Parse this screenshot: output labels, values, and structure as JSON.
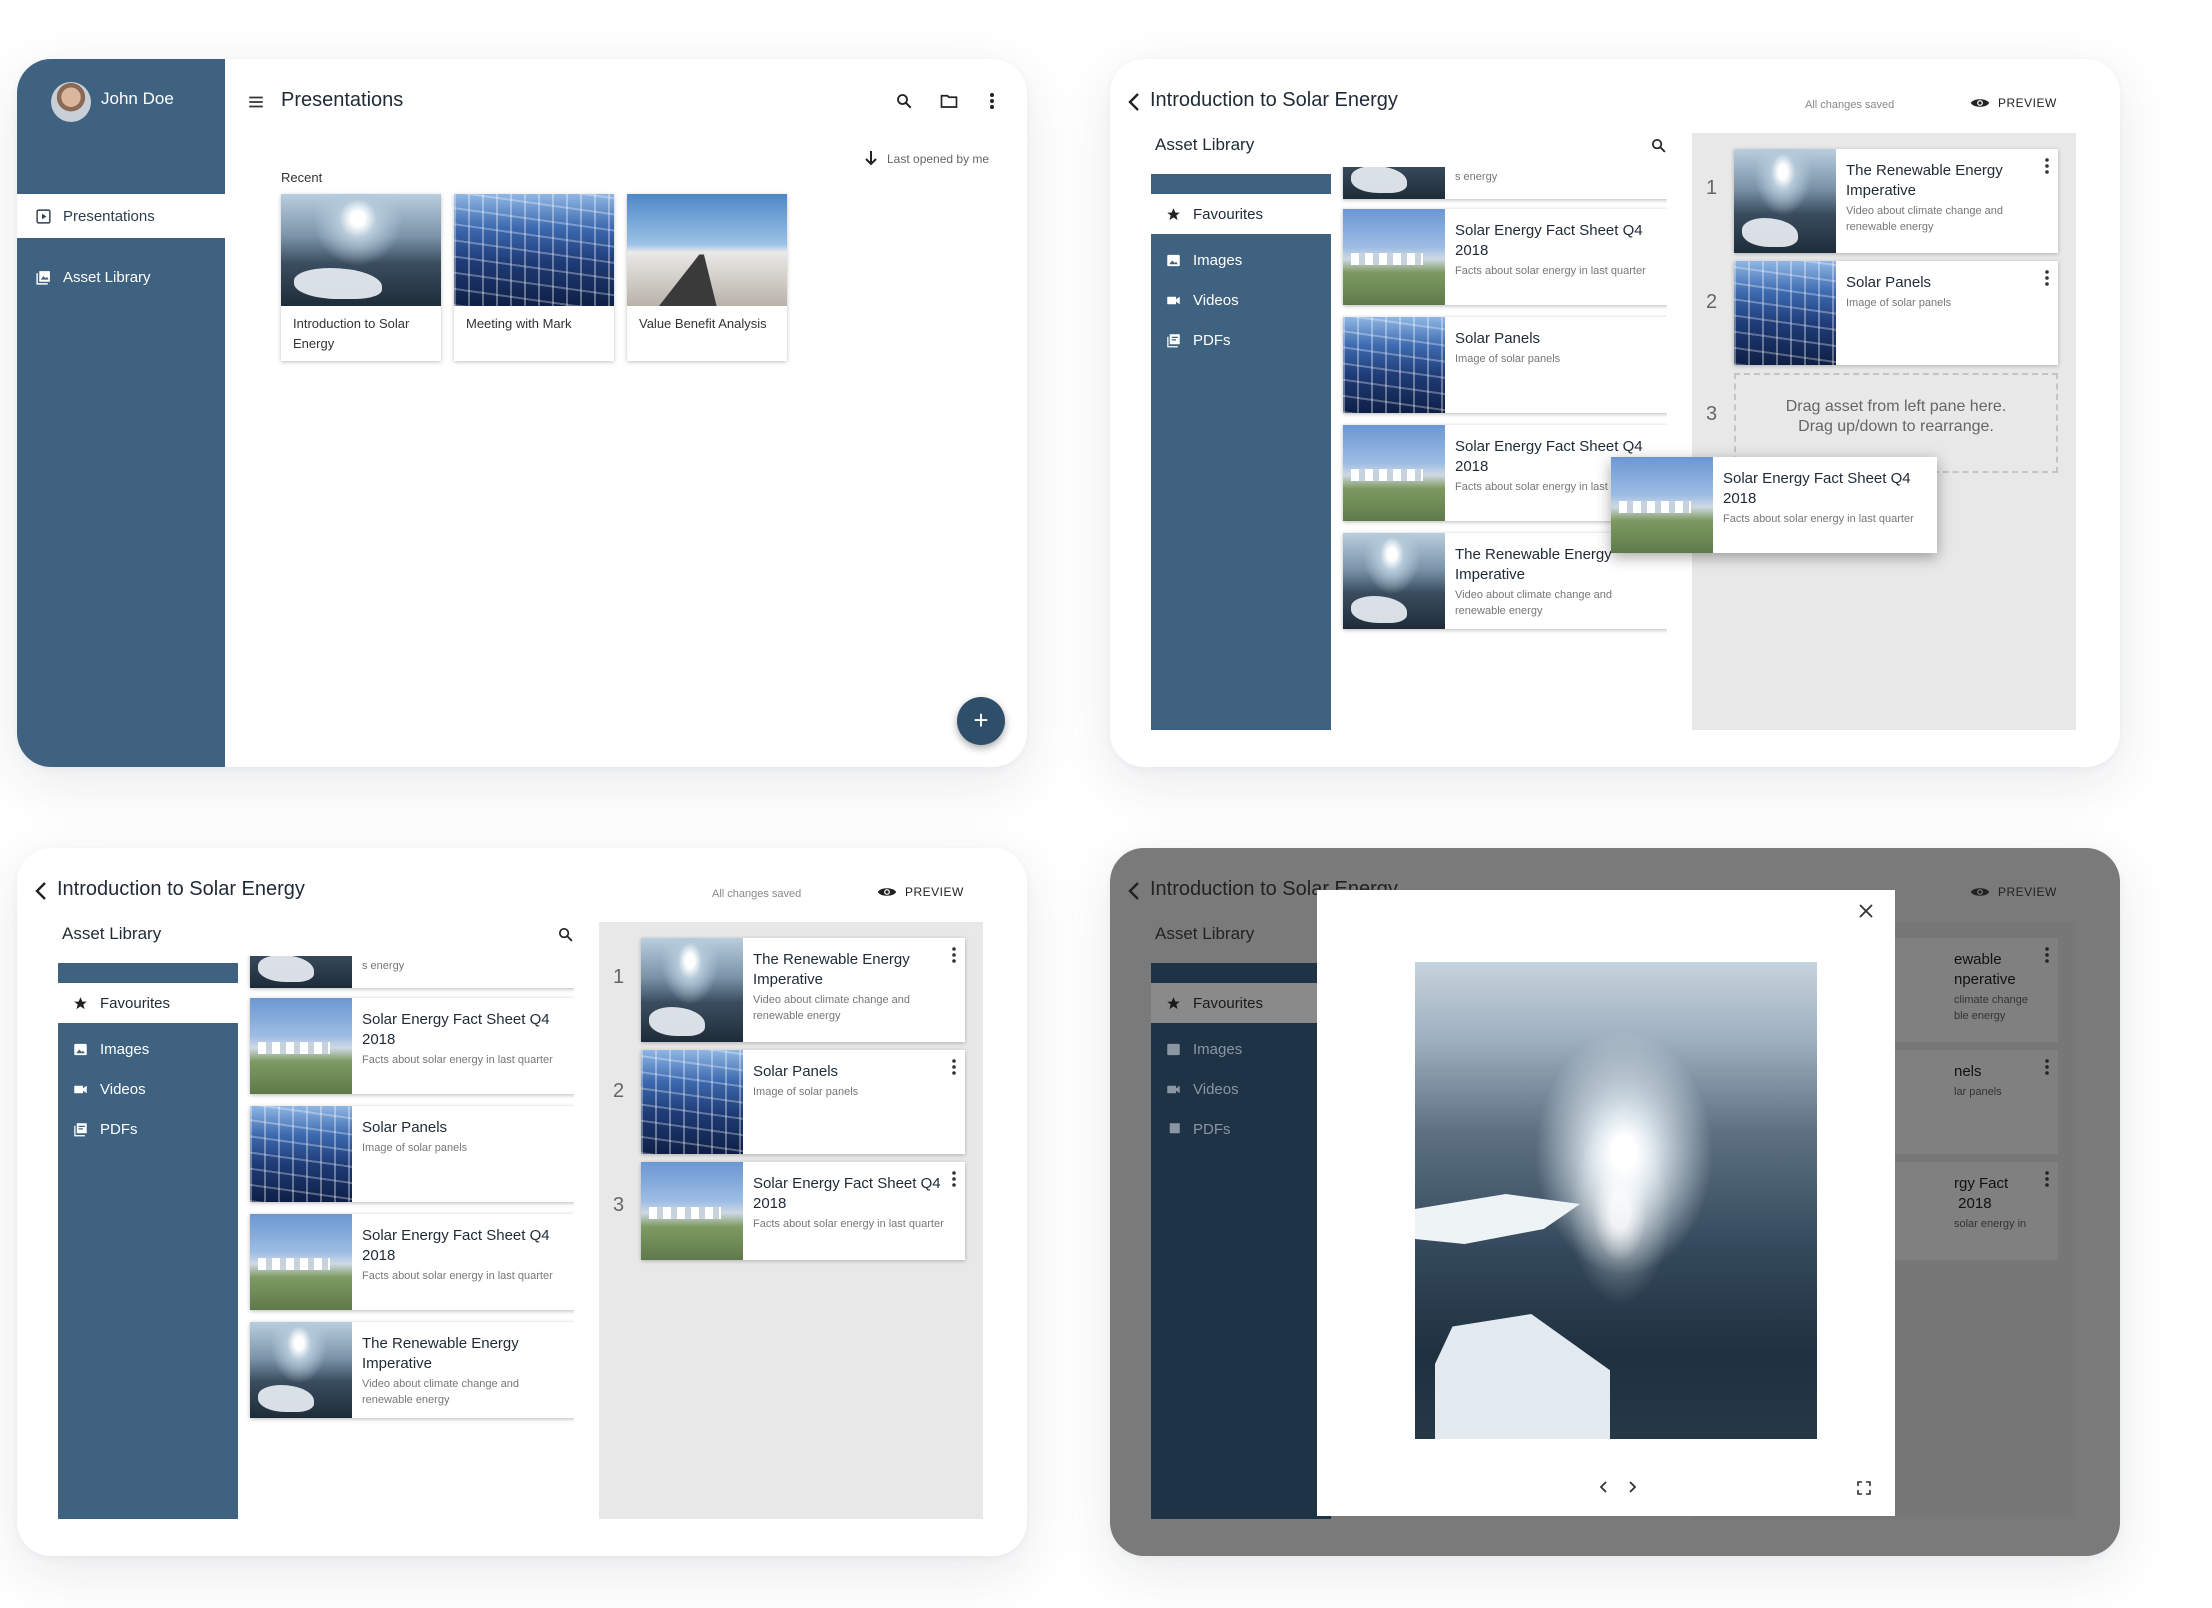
{
  "presentations_screen": {
    "user": {
      "name": "John Doe"
    },
    "nav": [
      {
        "label": "Presentations",
        "icon": "presentation-icon"
      },
      {
        "label": "Asset Library",
        "icon": "library-icon"
      }
    ],
    "title": "Presentations",
    "sort_label": "Last opened by me",
    "section_label": "Recent",
    "recent": [
      {
        "title": "Introduction to Solar Energy",
        "thumb": "ocean"
      },
      {
        "title": "Meeting with Mark",
        "thumb": "panels"
      },
      {
        "title": "Value Benefit Analysis",
        "thumb": "road"
      }
    ],
    "fab_label": "+"
  },
  "editor": {
    "title": "Introduction to Solar Energy",
    "save_status": "All changes saved",
    "preview_label": "PREVIEW",
    "library_title": "Asset Library",
    "library_nav": [
      {
        "label": "Favourites",
        "icon": "star-icon"
      },
      {
        "label": "Images",
        "icon": "image-icon"
      },
      {
        "label": "Videos",
        "icon": "video-icon"
      },
      {
        "label": "PDFs",
        "icon": "pdf-icon"
      }
    ],
    "partial_top_text": "s energy",
    "library_assets": [
      {
        "title": "Solar Energy Fact Sheet Q4 2018",
        "desc": "Facts about solar energy in last quarter",
        "thumb": "fact"
      },
      {
        "title": "Solar Panels",
        "desc": "Image of solar panels",
        "thumb": "panels"
      },
      {
        "title": "Solar Energy Fact Sheet Q4 2018",
        "desc": "Facts about solar energy in last quarter",
        "thumb": "fact"
      },
      {
        "title": "The Renewable Energy Imperative",
        "desc": "Video about climate change and renewable energy",
        "thumb": "ocean"
      }
    ],
    "slides_dragging": [
      {
        "num": "1",
        "title": "The Renewable Energy Imperative",
        "desc": "Video about climate change and renewable energy"
      },
      {
        "num": "2",
        "title": "Solar Panels",
        "desc": "Image of solar panels"
      },
      {
        "num": "3"
      }
    ],
    "drop_hint": "Drag asset from left pane here. Drag up/down to rearrange.",
    "dragged_card": {
      "title": "Solar Energy Fact Sheet Q4 2018",
      "desc": "Facts about solar energy in last quarter"
    },
    "slides_final": [
      {
        "num": "1",
        "title": "The Renewable Energy Imperative",
        "desc": "Video about climate change and renewable energy"
      },
      {
        "num": "2",
        "title": "Solar Panels",
        "desc": "Image of solar panels"
      },
      {
        "num": "3",
        "title": "Solar Energy Fact Sheet Q4 2018",
        "desc": "Facts about solar energy in last quarter"
      }
    ],
    "overlay_partials": {
      "title": "Introduction to Solar Energy",
      "s1_title": "ewable\nnperative",
      "s1_desc": "climate change\nble energy",
      "s2_title": "nels",
      "s2_desc": "lar panels",
      "s3_title": "rgy Fact\n 2018",
      "s3_desc": "solar energy in"
    }
  },
  "colors": {
    "sidebar": "#3f6280",
    "fab": "#2f4e6a",
    "pane": "#e8e8e8"
  }
}
